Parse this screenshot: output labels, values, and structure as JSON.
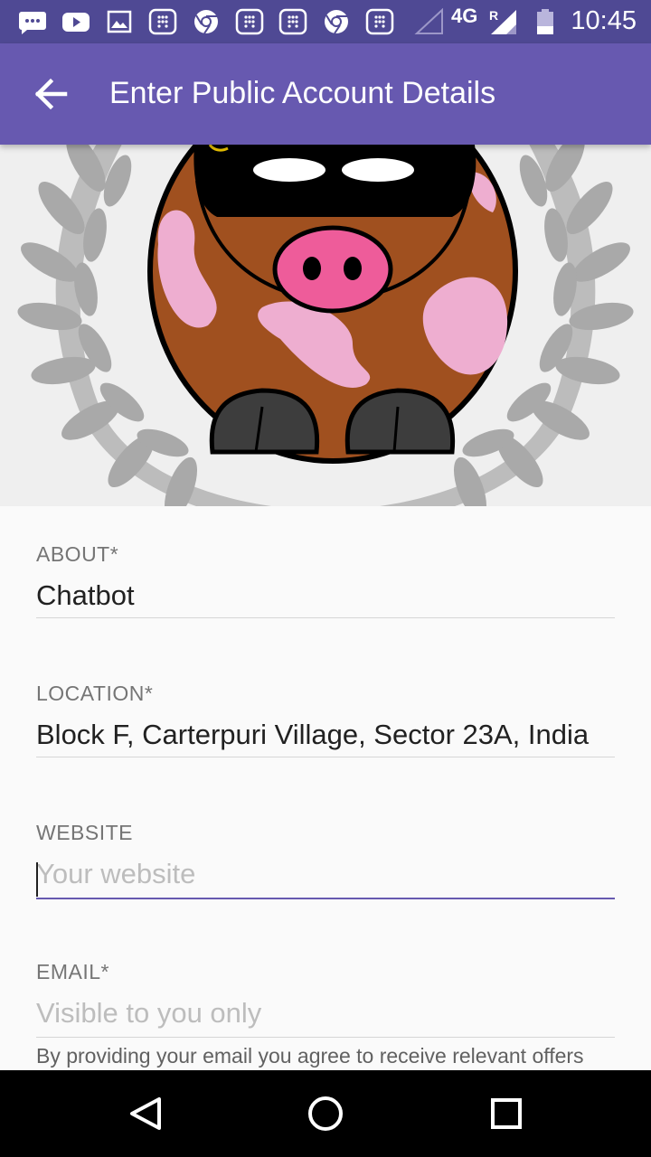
{
  "status_bar": {
    "network": "4G",
    "roaming": "R",
    "time": "10:45",
    "icons": [
      "message-icon",
      "youtube-icon",
      "image-icon",
      "app-grid-icon",
      "chrome-icon",
      "app-grid-icon",
      "app-grid-icon",
      "chrome-icon",
      "app-grid-icon",
      "signal-icon",
      "signal-roaming-icon",
      "battery-icon"
    ]
  },
  "app_bar": {
    "title": "Enter Public Account Details",
    "back_icon": "arrow-back-icon",
    "color": "#6759b0"
  },
  "form": {
    "about": {
      "label": "ABOUT*",
      "value": "Chatbot"
    },
    "location": {
      "label": "LOCATION*",
      "value": "Block F, Carterpuri Village, Sector 23A, India"
    },
    "website": {
      "label": "WEBSITE",
      "value": "",
      "placeholder": "Your website"
    },
    "email": {
      "label": "EMAIL*",
      "value": "",
      "placeholder": "Visible to you only",
      "help": "By providing your email you agree to receive relevant offers"
    }
  },
  "nav_bar": {
    "icons": [
      "back-triangle-icon",
      "home-circle-icon",
      "recents-square-icon"
    ]
  }
}
